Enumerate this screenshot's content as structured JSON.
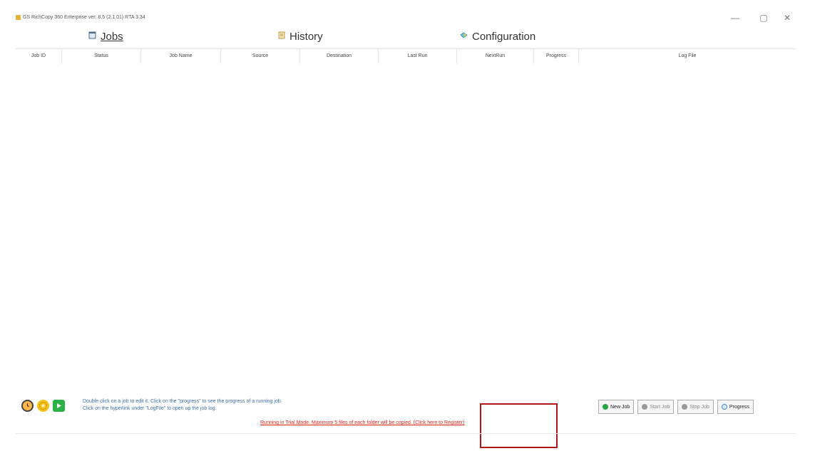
{
  "window": {
    "title": "GS RichCopy 360 Enterprise ver: 8.5 (2.1.01) RTA 3.34",
    "minimize_glyph": "—",
    "maximize_glyph": "▢",
    "close_glyph": "✕"
  },
  "nav": {
    "jobs": {
      "label": "Jobs",
      "icon": "jobs-icon"
    },
    "history": {
      "label": "History",
      "icon": "history-icon"
    },
    "configuration": {
      "label": "Configuration",
      "icon": "configuration-icon"
    }
  },
  "table": {
    "columns": [
      "Job ID",
      "Status",
      "Job Name",
      "Source",
      "Destination",
      "Last Run",
      "NextRun",
      "Progress",
      "Log File"
    ],
    "rows": []
  },
  "footer": {
    "help_line_1": "Double click on a job to edit it. Click on the \"progress\" to see the progress of a running job.",
    "help_line_2": "Click on the hyperlink under \"LogFile\" to open up the job log.",
    "trial_text": "Running in Trial Mode. Maximum 5 files of each folder will be copied.",
    "register_link": "(Click here to Register)",
    "buttons": {
      "new_job": "New Job",
      "start_job": "Start Job",
      "stop_job": "Stop Job",
      "progress": "Progress"
    }
  },
  "colors": {
    "help_text": "#3a6fb0",
    "trial_text": "#e02020",
    "highlight": "#b01818"
  }
}
